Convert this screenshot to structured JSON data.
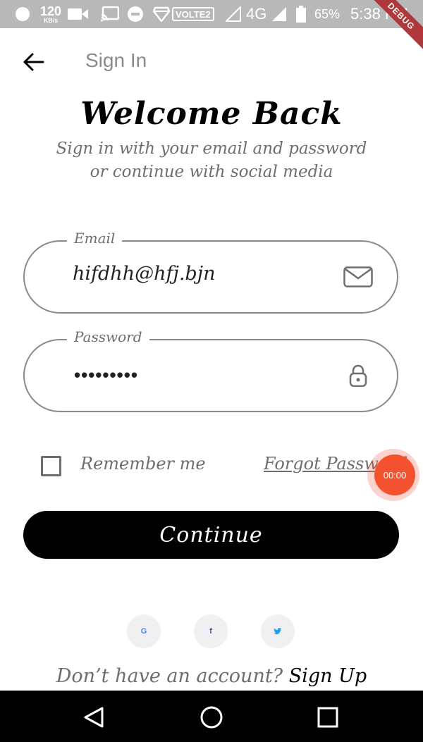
{
  "status_bar": {
    "net_speed_value": "120",
    "net_speed_unit": "KB/s",
    "volte": "VOLTE2",
    "network": "4G",
    "battery": "65%",
    "time": "5:38 PM"
  },
  "debug_banner": "DEBUG",
  "app_bar": {
    "title": "Sign In"
  },
  "header": {
    "title": "Welcome Back",
    "subtitle_line1": "Sign in with your email and password",
    "subtitle_line2": "or continue with social media"
  },
  "form": {
    "email_label": "Email",
    "email_value": "hifdhh@hfj.bjn",
    "password_label": "Password",
    "password_value": "•••••••••",
    "remember_label": "Remember me",
    "remember_checked": false,
    "forgot_label": "Forgot Password",
    "continue_label": "Continue"
  },
  "social": [
    {
      "icon": "google-icon",
      "glyph": "G",
      "color": "#4285F4"
    },
    {
      "icon": "facebook-icon",
      "glyph": "f",
      "color": "#3b5998"
    },
    {
      "icon": "twitter-icon",
      "glyph": "♥",
      "color": "#1da1f2"
    }
  ],
  "signup": {
    "question": "Don’t have an account?",
    "link": "Sign Up"
  },
  "recorder": {
    "time": "00:00"
  }
}
